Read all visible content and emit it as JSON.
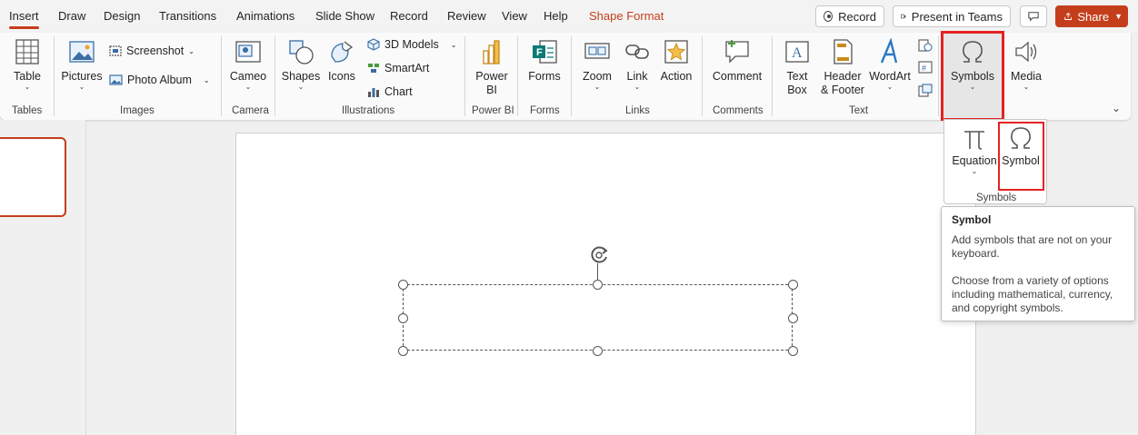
{
  "tabs": [
    "Insert",
    "Draw",
    "Design",
    "Transitions",
    "Animations",
    "Slide Show",
    "Record",
    "Review",
    "View",
    "Help",
    "Shape Format"
  ],
  "top_buttons": {
    "record": "Record",
    "present": "Present in Teams",
    "share": "Share"
  },
  "ribbon": {
    "table": "Table",
    "pictures": "Pictures",
    "screenshot": "Screenshot",
    "photo_album": "Photo Album",
    "cameo": "Cameo",
    "shapes": "Shapes",
    "icons": "Icons",
    "models3d": "3D Models",
    "smartart": "SmartArt",
    "chart": "Chart",
    "powerbi_line1": "Power",
    "powerbi_line2": "BI",
    "forms": "Forms",
    "zoom": "Zoom",
    "link": "Link",
    "action": "Action",
    "comment": "Comment",
    "textbox_line1": "Text",
    "textbox_line2": "Box",
    "header_line1": "Header",
    "header_line2": "& Footer",
    "wordart": "WordArt",
    "symbols": "Symbols",
    "media": "Media"
  },
  "groups": {
    "tables": "Tables",
    "images": "Images",
    "camera": "Camera",
    "illustrations": "Illustrations",
    "powerbi": "Power BI",
    "forms": "Forms",
    "links": "Links",
    "comments": "Comments",
    "text": "Text"
  },
  "dropdown": {
    "equation": "Equation",
    "symbol": "Symbol",
    "group": "Symbols"
  },
  "tooltip": {
    "title": "Symbol",
    "line1": "Add symbols that are not on your keyboard.",
    "line2": "Choose from a variety of options including mathematical, currency, and copyright symbols."
  },
  "colors": {
    "accent": "#c43e1c",
    "highlight": "#e52222"
  }
}
